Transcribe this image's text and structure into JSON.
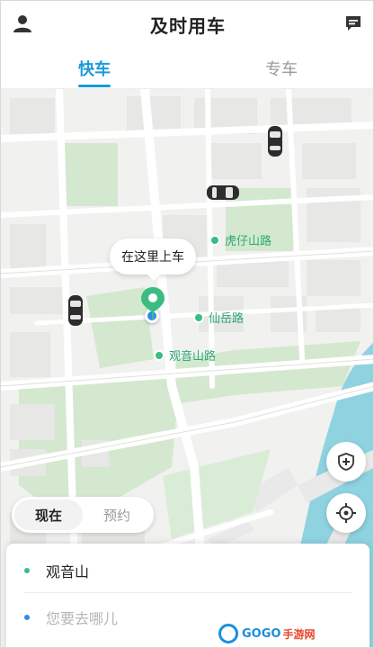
{
  "header": {
    "title": "及时用车",
    "profile_icon": "person-icon",
    "message_icon": "message-icon"
  },
  "tabs": [
    {
      "label": "快车",
      "active": true
    },
    {
      "label": "专车",
      "active": false
    }
  ],
  "map": {
    "pickup_tooltip": "在这里上车",
    "street_labels": [
      "虎仔山路",
      "仙岳路",
      "观音山路"
    ],
    "colors": {
      "accent": "#1a9bd7",
      "pickup_pin": "#3bbd82",
      "location_dot": "#2b8de8",
      "water": "#8fd3e0",
      "park": "#d4e8d0"
    }
  },
  "controls": {
    "safety_icon": "shield-plus-icon",
    "locate_icon": "crosshair-icon"
  },
  "time_toggle": {
    "now": "现在",
    "reserve": "预约",
    "selected": "现在"
  },
  "trip": {
    "from": "观音山",
    "to_placeholder": "您要去哪儿"
  },
  "watermark": {
    "brand": "GOGO",
    "suffix": "手游网"
  }
}
